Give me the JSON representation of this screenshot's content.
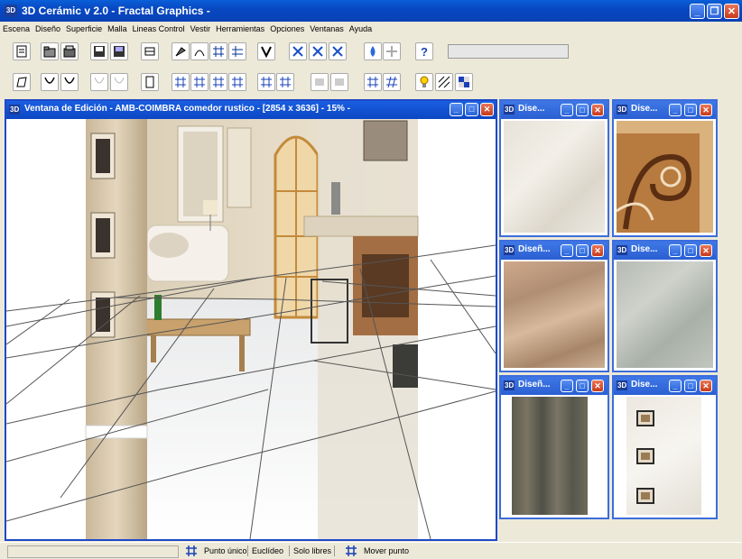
{
  "app": {
    "title": "3D Cerámic  v 2.0   - Fractal Graphics -",
    "icon": "3D"
  },
  "menu": [
    "Escena",
    "Diseño",
    "Superficie",
    "Malla",
    "Lineas Control",
    "Vestir",
    "Herramientas",
    "Opciones",
    "Ventanas",
    "Ayuda"
  ],
  "editor": {
    "icon": "3D",
    "title": "Ventana de Edición   - AMB-COIMBRA comedor rustico  -    [2854 x 3636]   - 15% -"
  },
  "designs": [
    {
      "title": "Dise...",
      "texture": "light-marble-tile"
    },
    {
      "title": "Dise...",
      "texture": "ornamental-border-tile"
    },
    {
      "title": "Diseñ...",
      "texture": "rustic-marble-tile"
    },
    {
      "title": "Dise...",
      "texture": "grey-stone-tile"
    },
    {
      "title": "Diseñ...",
      "texture": "wood-slate-tile"
    },
    {
      "title": "Dise...",
      "texture": "inset-decor-tile"
    }
  ],
  "status": {
    "point_mode": "Punto único",
    "euclid": "Euclídeo",
    "free_only": "Solo libres",
    "move_point": "Mover punto"
  },
  "colors": {
    "titlebar": "#0848c2",
    "window_border": "#1d49c8",
    "child_border": "#3c6ddc",
    "face": "#ece9d8"
  }
}
